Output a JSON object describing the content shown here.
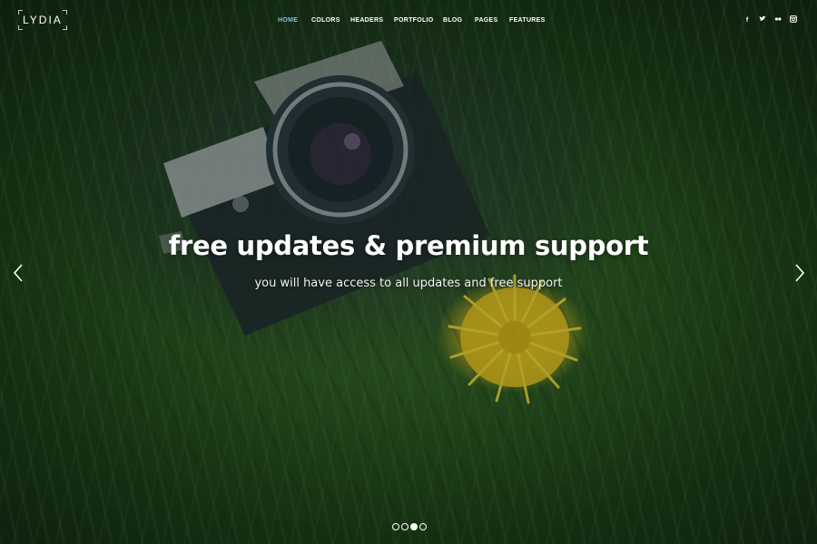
{
  "brand": {
    "logo_text": "LYDIA"
  },
  "nav": {
    "items": [
      {
        "label": "HOME",
        "active": true
      },
      {
        "label": "COLORS",
        "active": false
      },
      {
        "label": "HEADERS",
        "active": false
      },
      {
        "label": "PORTFOLIO",
        "active": false
      },
      {
        "label": "BLOG",
        "active": false
      },
      {
        "label": "PAGES",
        "active": false
      },
      {
        "label": "FEATURES",
        "active": false
      }
    ],
    "active_color": "#7fbfe0"
  },
  "social": {
    "icons": [
      "facebook-icon",
      "twitter-icon",
      "flickr-icon",
      "instagram-icon"
    ],
    "facebook_glyph": "f",
    "twitter_glyph": "★",
    "flickr_glyph": "●●",
    "instagram_glyph": "▣"
  },
  "hero": {
    "title": "free updates & premium support",
    "subtitle": "you will have access to all updates and free support"
  },
  "slider": {
    "prev_icon": "chevron-left-icon",
    "next_icon": "chevron-right-icon",
    "slide_count": 4,
    "active_slide": 3
  }
}
